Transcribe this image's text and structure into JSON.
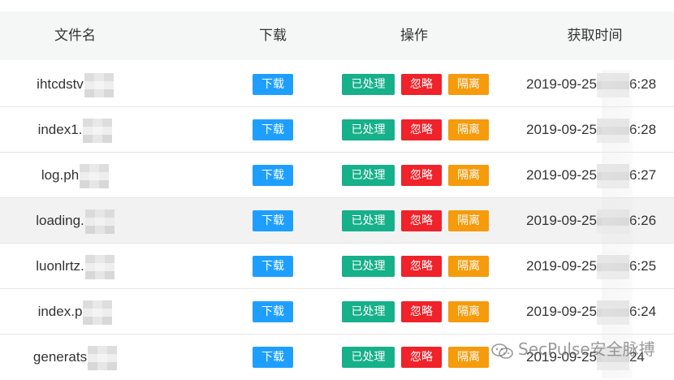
{
  "header": {
    "filename": "文件名",
    "download": "下载",
    "actions": "操作",
    "fetch_time": "获取时间"
  },
  "buttons": {
    "download": "下载",
    "processed": "已处理",
    "ignore": "忽略",
    "isolate": "隔离"
  },
  "colors": {
    "download": "#1e9fff",
    "processed": "#16b08a",
    "ignore": "#f0222a",
    "isolate": "#f59b0c"
  },
  "rows": [
    {
      "filename": "ihtcdstv",
      "time_prefix": "2019-09-25",
      "time_suffix": "6:28"
    },
    {
      "filename": "index1.",
      "time_prefix": "2019-09-25",
      "time_suffix": "6:28"
    },
    {
      "filename": "log.ph",
      "time_prefix": "2019-09-25",
      "time_suffix": "6:27"
    },
    {
      "filename": "loading.",
      "time_prefix": "2019-09-25",
      "time_suffix": "6:26"
    },
    {
      "filename": "luonlrtz.",
      "time_prefix": "2019-09-25",
      "time_suffix": "6:25"
    },
    {
      "filename": "index.p",
      "time_prefix": "2019-09-25",
      "time_suffix": "6:24"
    },
    {
      "filename": "generats",
      "time_prefix": "2019-09-25",
      "time_suffix": "24"
    }
  ],
  "watermark": {
    "text": "SecPulse安全脉搏",
    "icon": "wechat-icon"
  }
}
